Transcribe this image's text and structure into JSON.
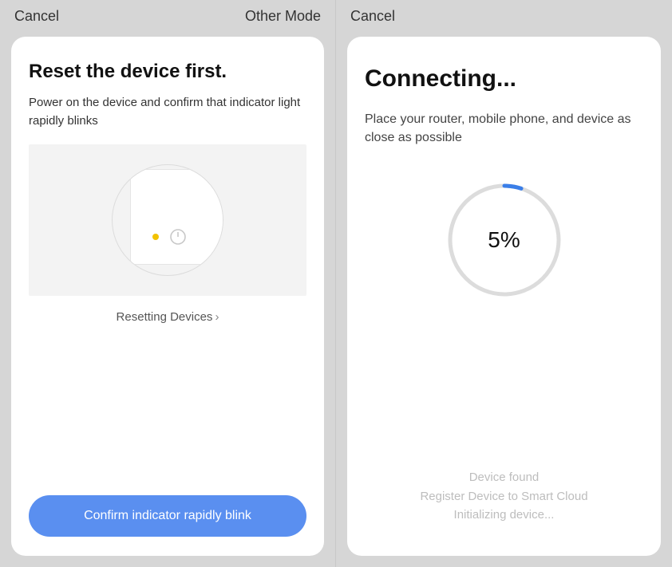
{
  "left": {
    "cancel": "Cancel",
    "other_mode": "Other Mode",
    "title": "Reset the device first.",
    "description": "Power on the device and confirm that indicator light rapidly blinks",
    "reset_link": "Resetting Devices",
    "confirm_button": "Confirm indicator rapidly blink"
  },
  "right": {
    "cancel": "Cancel",
    "title": "Connecting...",
    "description": "Place your router, mobile phone, and device as close as possible",
    "progress_percent": 5,
    "progress_label": "5%",
    "status_1": "Device found",
    "status_2": "Register Device to Smart Cloud",
    "status_3": "Initializing device..."
  }
}
